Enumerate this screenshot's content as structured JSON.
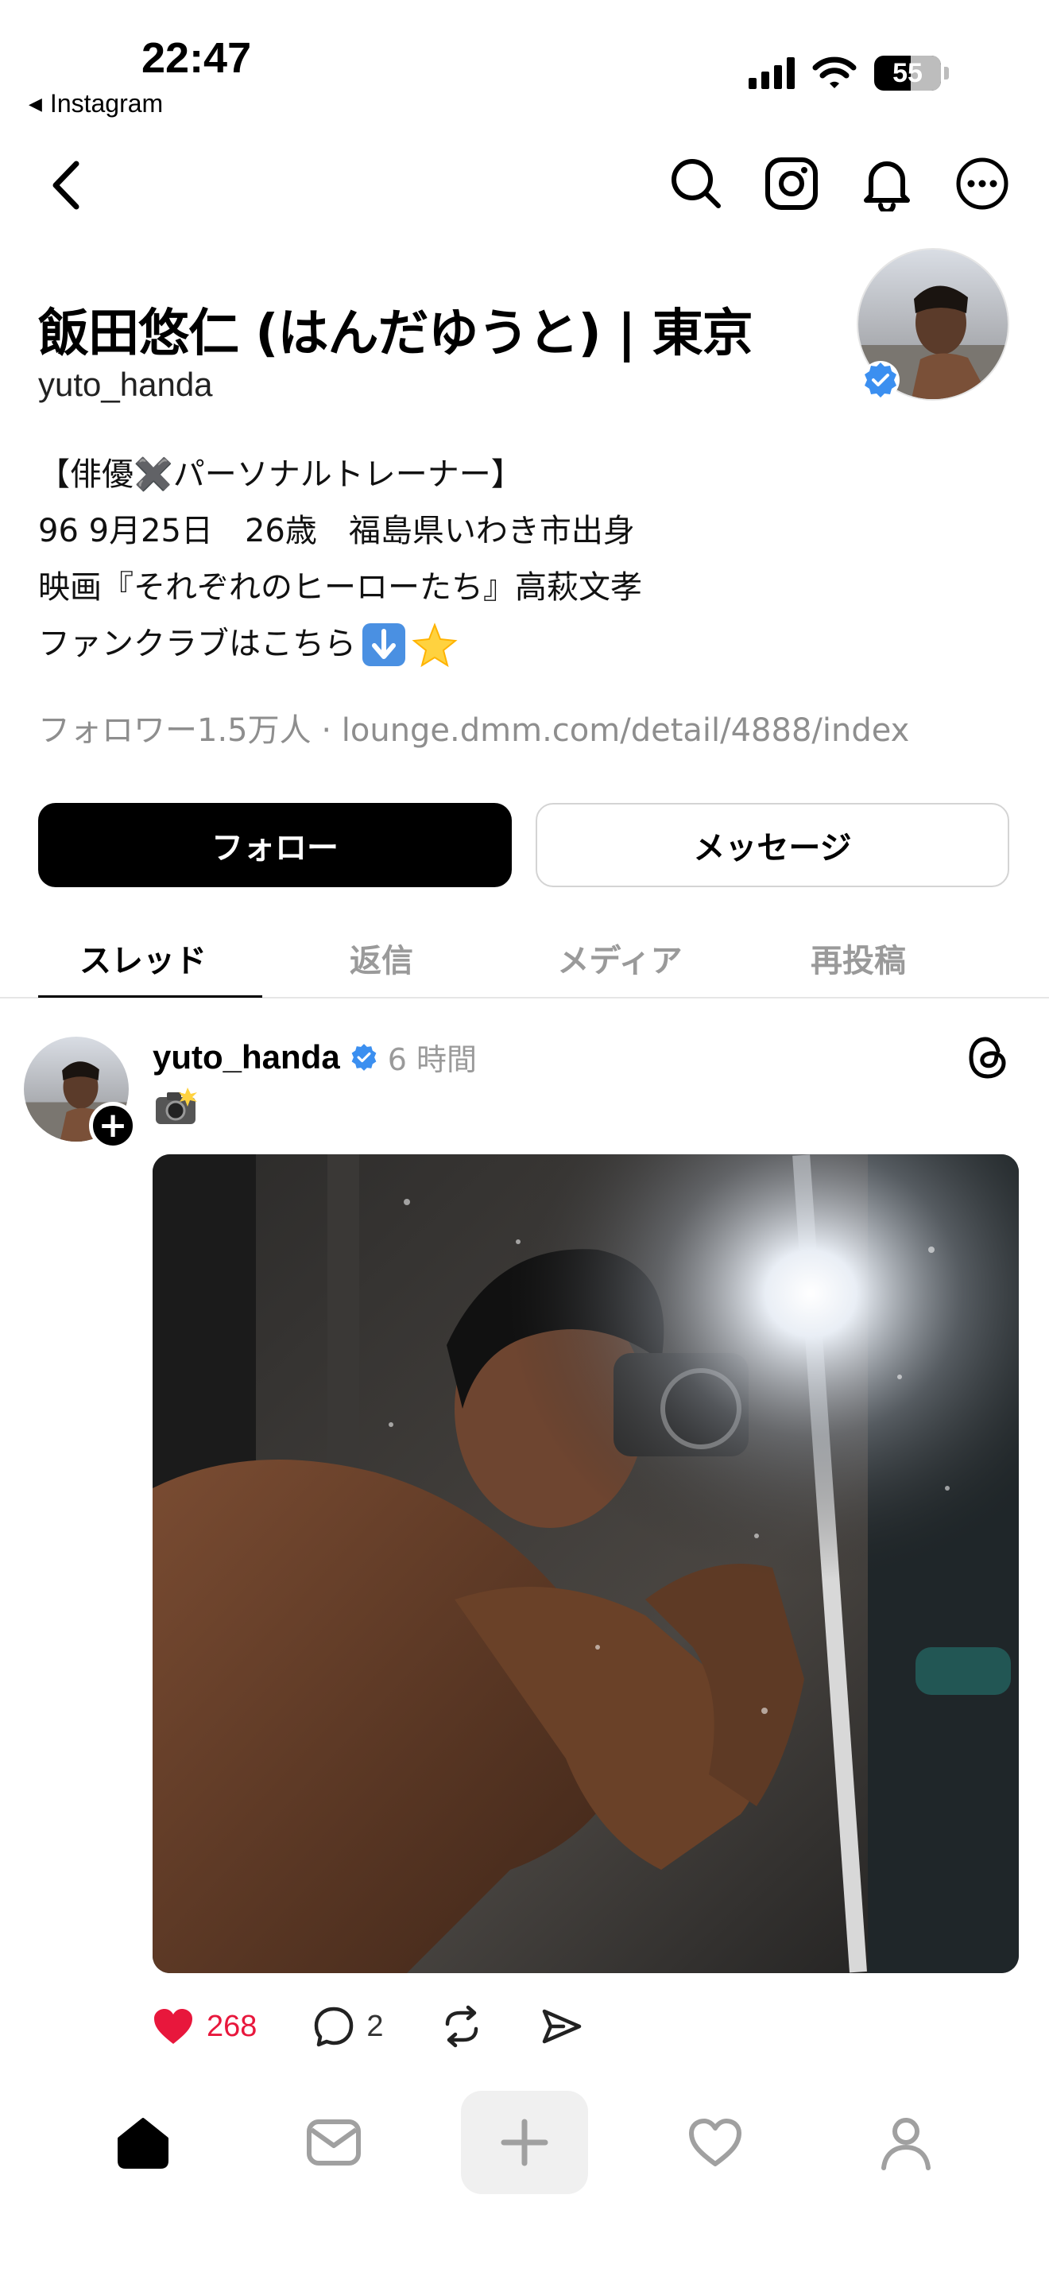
{
  "status_bar": {
    "time": "22:47",
    "back_app": "Instagram",
    "battery": "55"
  },
  "profile": {
    "name": "飯田悠仁 (はんだゆうと) | 東京",
    "handle": "yuto_handa",
    "bio": [
      "【俳優✖️パーソナルトレーナー】",
      "96 9月25日　26歳　福島県いわき市出身",
      "映画『それぞれのヒーローたち』高萩文孝",
      "ファンクラブはこちら"
    ],
    "bio_emojis": [
      "arrow-down-icon",
      "glowing-star-icon"
    ],
    "followers_line": "フォロワー1.5万人 · lounge.dmm.com/detail/4888/index",
    "verified": true
  },
  "buttons": {
    "follow": "フォロー",
    "message": "メッセージ"
  },
  "tabs": [
    {
      "label": "スレッド",
      "active": true
    },
    {
      "label": "返信",
      "active": false
    },
    {
      "label": "メディア",
      "active": false
    },
    {
      "label": "再投稿",
      "active": false
    }
  ],
  "post": {
    "username": "yuto_handa",
    "time": "6 時間",
    "caption_emoji": "camera-with-flash-icon",
    "likes": "268",
    "comments": "2"
  },
  "colors": {
    "like": "#e8173c",
    "verified": "#3b8ff0",
    "muted": "#8e8e8e"
  }
}
